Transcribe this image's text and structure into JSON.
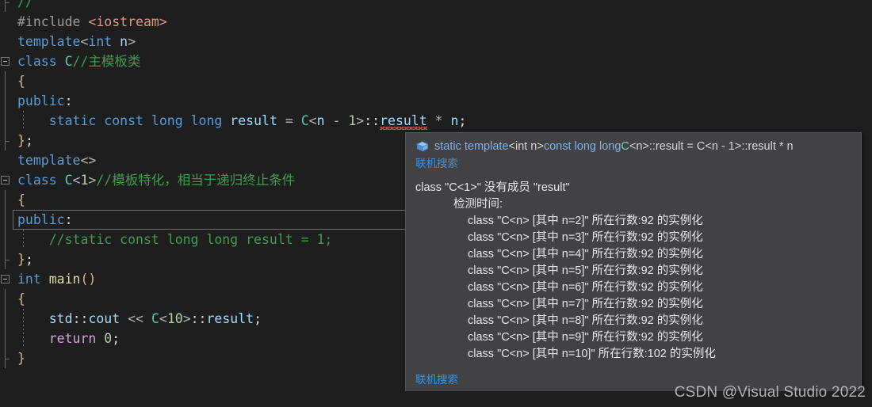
{
  "editor": {
    "language": "C++",
    "lines": [
      {
        "id": "l0",
        "indent": 0,
        "fold": "end-top",
        "html_key": "partial_comment",
        "text": "//"
      },
      {
        "id": "l1",
        "text": "#include <iostream>"
      },
      {
        "id": "l2",
        "text": "template<int n>"
      },
      {
        "id": "l3",
        "text": "class C//主模板类"
      },
      {
        "id": "l4",
        "text": "{"
      },
      {
        "id": "l5",
        "text": "public:"
      },
      {
        "id": "l6",
        "text": "    static const long long result = C<n - 1>::result * n;"
      },
      {
        "id": "l7",
        "text": "};"
      },
      {
        "id": "l8",
        "text": "template<>"
      },
      {
        "id": "l9",
        "text": "class C<1>//模板特化，相当于递归终止条件"
      },
      {
        "id": "l10",
        "text": "{"
      },
      {
        "id": "l11",
        "text": "public:"
      },
      {
        "id": "l12",
        "text": "    //static const long long result = 1;"
      },
      {
        "id": "l13",
        "text": "};"
      },
      {
        "id": "l14",
        "text": "int main()"
      },
      {
        "id": "l15",
        "text": "{"
      },
      {
        "id": "l16",
        "text": "    std::cout << C<10>::result;"
      },
      {
        "id": "l17",
        "text": "    return 0;"
      },
      {
        "id": "l18",
        "text": "}"
      }
    ],
    "error_token": "result",
    "current_line_id": "l8"
  },
  "tooltip": {
    "icon": "constant-field-box-icon",
    "signature": {
      "prefix": "static template",
      "tparams": "<int n>",
      "qualifiers": " const long long ",
      "classname": "C",
      "rest": "<n>::result = C<n - 1>::result * n"
    },
    "top_link": "联机搜索",
    "message": "class \"C<1>\" 没有成员 \"result\"",
    "subheading": "检测时间:",
    "instantiations": [
      "class \"C<n> [其中 n=2]\" 所在行数:92 的实例化",
      "class \"C<n> [其中 n=3]\" 所在行数:92 的实例化",
      "class \"C<n> [其中 n=4]\" 所在行数:92 的实例化",
      "class \"C<n> [其中 n=5]\" 所在行数:92 的实例化",
      "class \"C<n> [其中 n=6]\" 所在行数:92 的实例化",
      "class \"C<n> [其中 n=7]\" 所在行数:92 的实例化",
      "class \"C<n> [其中 n=8]\" 所在行数:92 的实例化",
      "class \"C<n> [其中 n=9]\" 所在行数:92 的实例化",
      "class \"C<n> [其中 n=10]\" 所在行数:102 的实例化"
    ],
    "bottom_link": "联机搜索"
  },
  "watermark": "CSDN @Visual Studio 2022",
  "colors": {
    "editor_bg": "#1e1e1e",
    "tooltip_bg": "#424245",
    "tooltip_border": "#55555a",
    "link": "#3a92e5",
    "keyword": "#569cd6",
    "type": "#4ec9b0",
    "comment": "#3f9c4f",
    "string": "#d69d85",
    "number": "#b5cea8",
    "error_squiggle": "#e04a4a",
    "watermark": "#c8c8c8"
  }
}
